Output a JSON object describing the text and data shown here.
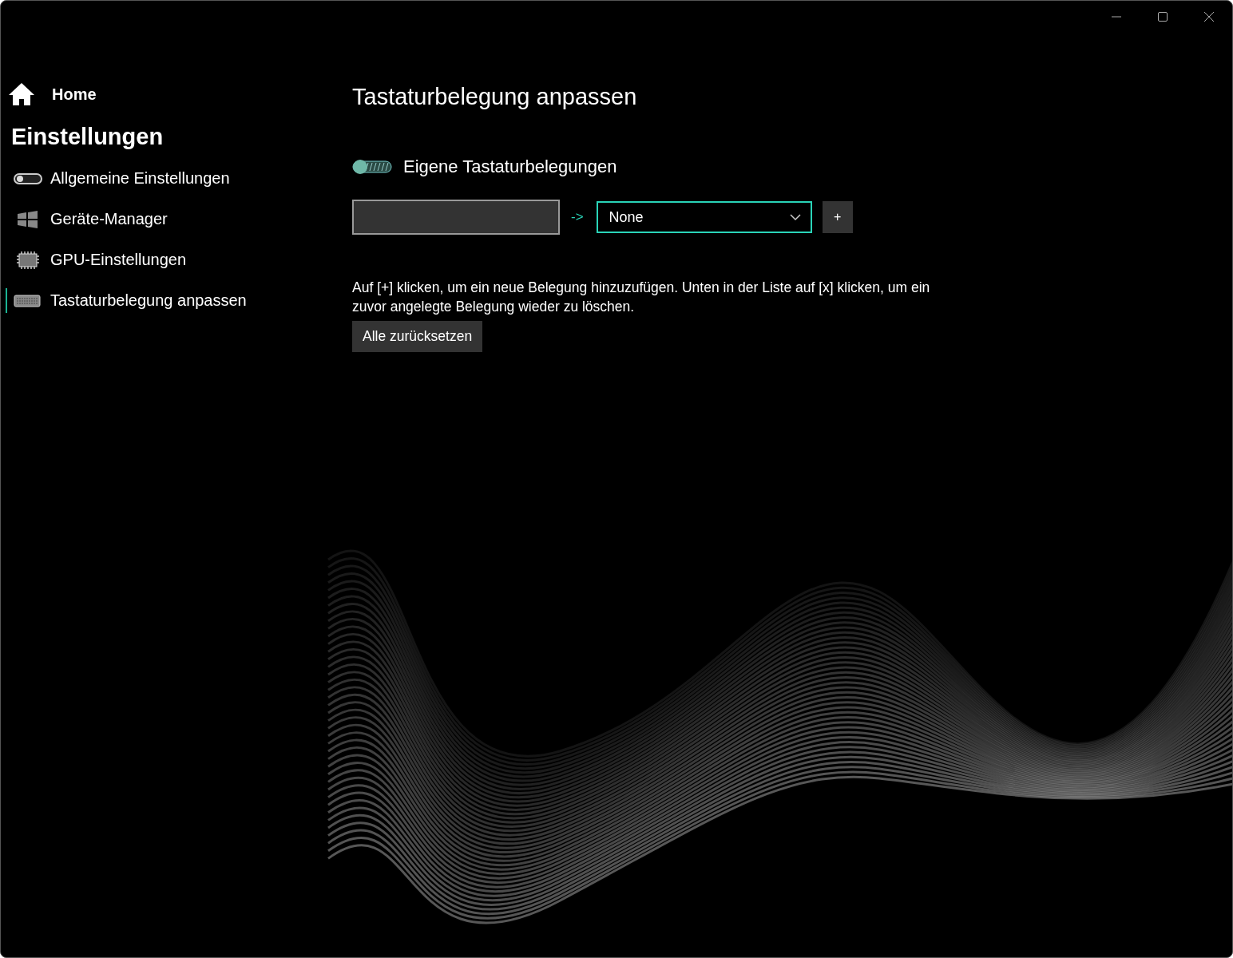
{
  "sidebar": {
    "home": "Home",
    "heading": "Einstellungen",
    "items": [
      {
        "label": "Allgemeine Einstellungen",
        "kind": "toggle",
        "selected": false
      },
      {
        "label": "Geräte-Manager",
        "kind": "windows",
        "selected": false
      },
      {
        "label": "GPU-Einstellungen",
        "kind": "chip",
        "selected": false
      },
      {
        "label": "Tastaturbelegung anpassen",
        "kind": "keyboard",
        "selected": true
      }
    ]
  },
  "page": {
    "title": "Tastaturbelegung anpassen",
    "toggle": {
      "label": "Eigene Tastaturbelegungen",
      "on": false
    },
    "mapping": {
      "arrow": "->",
      "dropdown_value": "None",
      "add_button": "+"
    },
    "help": "Auf [+] klicken, um ein neue Belegung hinzuzufügen. Unten in der Liste auf [x] klicken, um ein zuvor angelegte Belegung wieder zu löschen.",
    "reset_button": "Alle zurücksetzen"
  }
}
